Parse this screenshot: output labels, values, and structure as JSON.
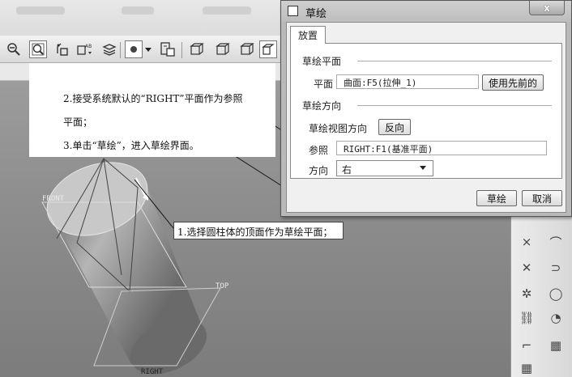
{
  "dialog": {
    "title": "草绘",
    "close_label": "x",
    "tab_placement": "放置",
    "sketch_plane": {
      "group_title": "草绘平面",
      "plane_label": "平面",
      "plane_value": "曲面:F5(拉伸_1)",
      "use_previous_button": "使用先前的"
    },
    "sketch_orientation": {
      "group_title": "草绘方向",
      "view_direction_label": "草绘视图方向",
      "flip_button": "反向",
      "reference_label": "参照",
      "reference_value": "RIGHT:F1(基准平面)",
      "direction_label": "方向",
      "direction_value": "右"
    },
    "sketch_button": "草绘",
    "cancel_button": "取消"
  },
  "callouts": {
    "step2_line1": "2.接受系统默认的“RIGHT”平面作为参照",
    "step2_line2": "平面；",
    "step3": "3.单击“草绘”，进入草绘界面。",
    "step1": "1.选择圆柱体的顶面作为草绘平面；"
  },
  "datum_labels": {
    "front": "FRONT",
    "top": "TOP",
    "right": "RIGHT"
  },
  "toolbar": {
    "icons": [
      "zoom-out-icon",
      "zoom-fit-icon",
      "orient-icon",
      "annotation-icon",
      "layer-icon",
      "display-style-icon",
      "dropdown-icon",
      "save-view-icon",
      "datum-plane-icon",
      "datum-axis-icon",
      "datum-point-icon",
      "datum-csys-icon"
    ]
  },
  "right_toolbar": {
    "icons": [
      "axis-cross-icon",
      "point-icon",
      "spin-icon",
      "coordinate-icon",
      "chain-icon",
      "arc-icon",
      "dimension-icon",
      "table-icon"
    ]
  }
}
